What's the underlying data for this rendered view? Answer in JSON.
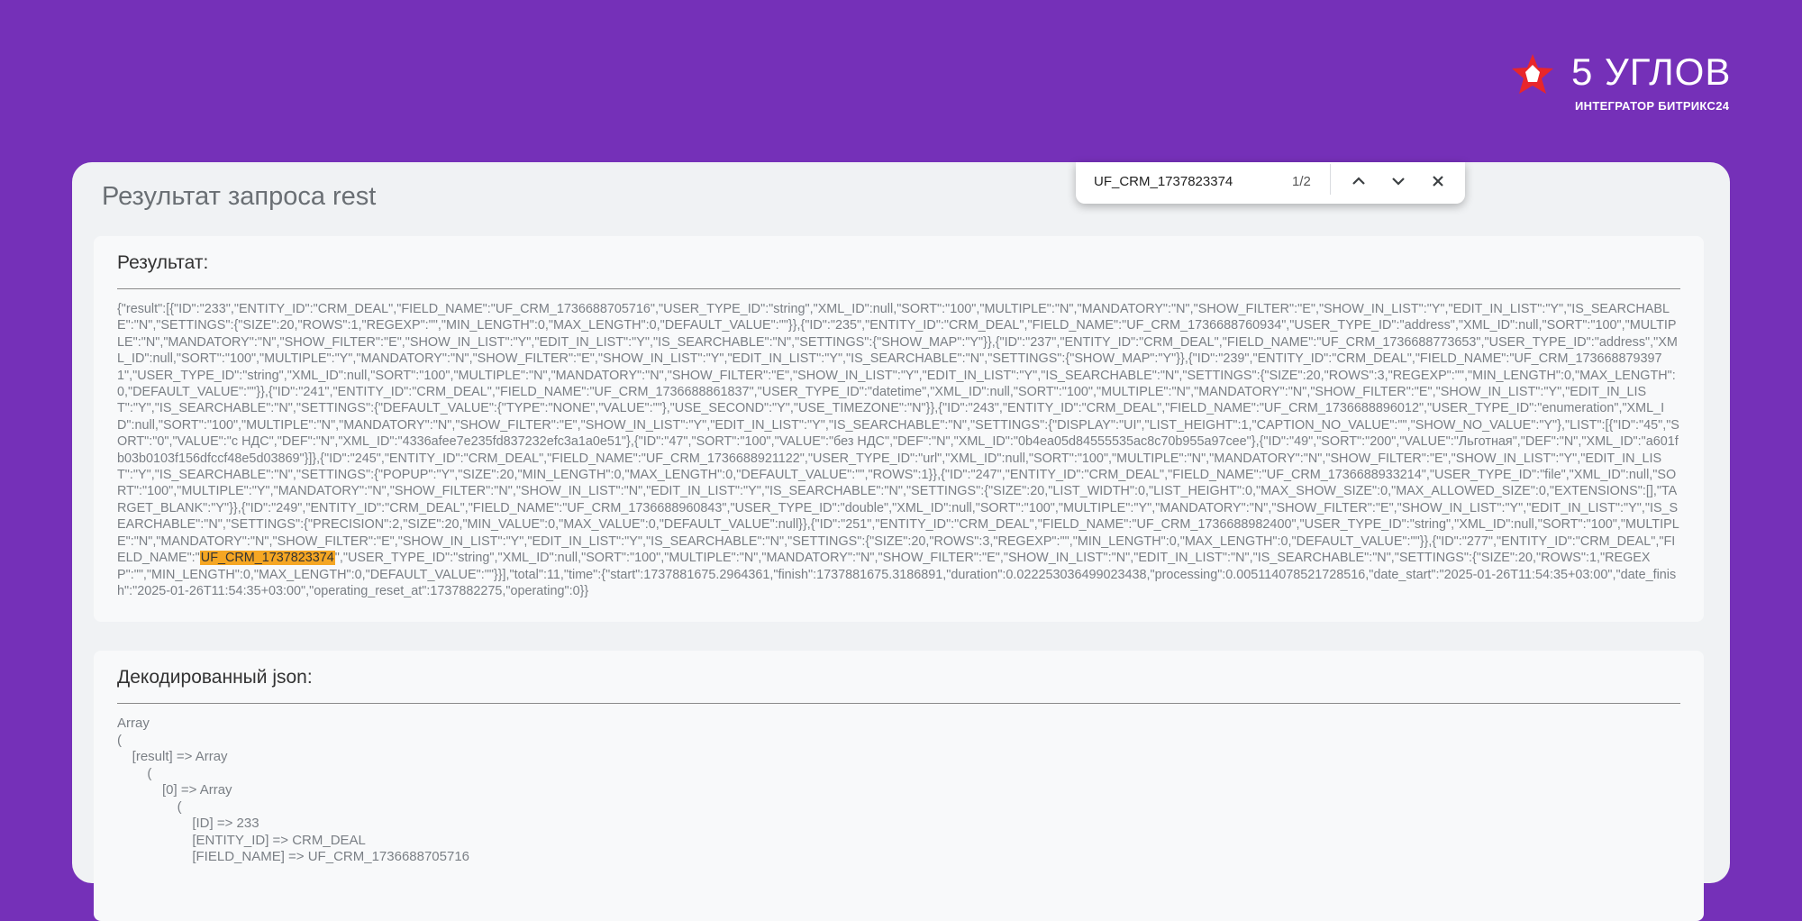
{
  "brand": {
    "name": "5 УГЛОВ",
    "tagline": "ИНТЕГРАТОР БИТРИКС24",
    "logo_icon": "red-star-icon",
    "colors": {
      "background": "#7530b8",
      "logo_accent": "#e8262b"
    }
  },
  "page": {
    "title": "Результат запроса rest"
  },
  "find_bar": {
    "query": "UF_CRM_1737823374",
    "count": "1/2",
    "icons": {
      "prev": "chevron-up-icon",
      "next": "chevron-down-icon",
      "close": "close-icon"
    },
    "highlight_color": "#f5a623"
  },
  "result": {
    "heading": "Результат:",
    "raw_before": "{\"result\":[{\"ID\":\"233\",\"ENTITY_ID\":\"CRM_DEAL\",\"FIELD_NAME\":\"UF_CRM_1736688705716\",\"USER_TYPE_ID\":\"string\",\"XML_ID\":null,\"SORT\":\"100\",\"MULTIPLE\":\"N\",\"MANDATORY\":\"N\",\"SHOW_FILTER\":\"E\",\"SHOW_IN_LIST\":\"Y\",\"EDIT_IN_LIST\":\"Y\",\"IS_SEARCHABLE\":\"N\",\"SETTINGS\":{\"SIZE\":20,\"ROWS\":1,\"REGEXP\":\"\",\"MIN_LENGTH\":0,\"MAX_LENGTH\":0,\"DEFAULT_VALUE\":\"\"}},{\"ID\":\"235\",\"ENTITY_ID\":\"CRM_DEAL\",\"FIELD_NAME\":\"UF_CRM_1736688760934\",\"USER_TYPE_ID\":\"address\",\"XML_ID\":null,\"SORT\":\"100\",\"MULTIPLE\":\"N\",\"MANDATORY\":\"N\",\"SHOW_FILTER\":\"E\",\"SHOW_IN_LIST\":\"Y\",\"EDIT_IN_LIST\":\"Y\",\"IS_SEARCHABLE\":\"N\",\"SETTINGS\":{\"SHOW_MAP\":\"Y\"}},{\"ID\":\"237\",\"ENTITY_ID\":\"CRM_DEAL\",\"FIELD_NAME\":\"UF_CRM_1736688773653\",\"USER_TYPE_ID\":\"address\",\"XML_ID\":null,\"SORT\":\"100\",\"MULTIPLE\":\"Y\",\"MANDATORY\":\"N\",\"SHOW_FILTER\":\"E\",\"SHOW_IN_LIST\":\"Y\",\"EDIT_IN_LIST\":\"Y\",\"IS_SEARCHABLE\":\"N\",\"SETTINGS\":{\"SHOW_MAP\":\"Y\"}},{\"ID\":\"239\",\"ENTITY_ID\":\"CRM_DEAL\",\"FIELD_NAME\":\"UF_CRM_1736688793971\",\"USER_TYPE_ID\":\"string\",\"XML_ID\":null,\"SORT\":\"100\",\"MULTIPLE\":\"N\",\"MANDATORY\":\"N\",\"SHOW_FILTER\":\"E\",\"SHOW_IN_LIST\":\"Y\",\"EDIT_IN_LIST\":\"Y\",\"IS_SEARCHABLE\":\"N\",\"SETTINGS\":{\"SIZE\":20,\"ROWS\":3,\"REGEXP\":\"\",\"MIN_LENGTH\":0,\"MAX_LENGTH\":0,\"DEFAULT_VALUE\":\"\"}},{\"ID\":\"241\",\"ENTITY_ID\":\"CRM_DEAL\",\"FIELD_NAME\":\"UF_CRM_1736688861837\",\"USER_TYPE_ID\":\"datetime\",\"XML_ID\":null,\"SORT\":\"100\",\"MULTIPLE\":\"N\",\"MANDATORY\":\"N\",\"SHOW_FILTER\":\"E\",\"SHOW_IN_LIST\":\"Y\",\"EDIT_IN_LIST\":\"Y\",\"IS_SEARCHABLE\":\"N\",\"SETTINGS\":{\"DEFAULT_VALUE\":{\"TYPE\":\"NONE\",\"VALUE\":\"\"},\"USE_SECOND\":\"Y\",\"USE_TIMEZONE\":\"N\"}},{\"ID\":\"243\",\"ENTITY_ID\":\"CRM_DEAL\",\"FIELD_NAME\":\"UF_CRM_1736688896012\",\"USER_TYPE_ID\":\"enumeration\",\"XML_ID\":null,\"SORT\":\"100\",\"MULTIPLE\":\"N\",\"MANDATORY\":\"N\",\"SHOW_FILTER\":\"E\",\"SHOW_IN_LIST\":\"Y\",\"EDIT_IN_LIST\":\"Y\",\"IS_SEARCHABLE\":\"N\",\"SETTINGS\":{\"DISPLAY\":\"UI\",\"LIST_HEIGHT\":1,\"CAPTION_NO_VALUE\":\"\",\"SHOW_NO_VALUE\":\"Y\"},\"LIST\":[{\"ID\":\"45\",\"SORT\":\"0\",\"VALUE\":\"с НДС\",\"DEF\":\"N\",\"XML_ID\":\"4336afee7e235fd837232efc3a1a0e51\"},{\"ID\":\"47\",\"SORT\":\"100\",\"VALUE\":\"без НДС\",\"DEF\":\"N\",\"XML_ID\":\"0b4ea05d84555535ac8c70b955a97cee\"},{\"ID\":\"49\",\"SORT\":\"200\",\"VALUE\":\"Льготная\",\"DEF\":\"N\",\"XML_ID\":\"a601fb03b0103f156dfccf48e5d03869\"}]},{\"ID\":\"245\",\"ENTITY_ID\":\"CRM_DEAL\",\"FIELD_NAME\":\"UF_CRM_1736688921122\",\"USER_TYPE_ID\":\"url\",\"XML_ID\":null,\"SORT\":\"100\",\"MULTIPLE\":\"N\",\"MANDATORY\":\"N\",\"SHOW_FILTER\":\"E\",\"SHOW_IN_LIST\":\"Y\",\"EDIT_IN_LIST\":\"Y\",\"IS_SEARCHABLE\":\"N\",\"SETTINGS\":{\"POPUP\":\"Y\",\"SIZE\":20,\"MIN_LENGTH\":0,\"MAX_LENGTH\":0,\"DEFAULT_VALUE\":\"\",\"ROWS\":1}},{\"ID\":\"247\",\"ENTITY_ID\":\"CRM_DEAL\",\"FIELD_NAME\":\"UF_CRM_1736688933214\",\"USER_TYPE_ID\":\"file\",\"XML_ID\":null,\"SORT\":\"100\",\"MULTIPLE\":\"Y\",\"MANDATORY\":\"N\",\"SHOW_FILTER\":\"N\",\"SHOW_IN_LIST\":\"N\",\"EDIT_IN_LIST\":\"Y\",\"IS_SEARCHABLE\":\"N\",\"SETTINGS\":{\"SIZE\":20,\"LIST_WIDTH\":0,\"LIST_HEIGHT\":0,\"MAX_SHOW_SIZE\":0,\"MAX_ALLOWED_SIZE\":0,\"EXTENSIONS\":[],\"TARGET_BLANK\":\"Y\"}},{\"ID\":\"249\",\"ENTITY_ID\":\"CRM_DEAL\",\"FIELD_NAME\":\"UF_CRM_1736688960843\",\"USER_TYPE_ID\":\"double\",\"XML_ID\":null,\"SORT\":\"100\",\"MULTIPLE\":\"Y\",\"MANDATORY\":\"N\",\"SHOW_FILTER\":\"E\",\"SHOW_IN_LIST\":\"Y\",\"EDIT_IN_LIST\":\"Y\",\"IS_SEARCHABLE\":\"N\",\"SETTINGS\":{\"PRECISION\":2,\"SIZE\":20,\"MIN_VALUE\":0,\"MAX_VALUE\":0,\"DEFAULT_VALUE\":null}},{\"ID\":\"251\",\"ENTITY_ID\":\"CRM_DEAL\",\"FIELD_NAME\":\"UF_CRM_1736688982400\",\"USER_TYPE_ID\":\"string\",\"XML_ID\":null,\"SORT\":\"100\",\"MULTIPLE\":\"N\",\"MANDATORY\":\"N\",\"SHOW_FILTER\":\"E\",\"SHOW_IN_LIST\":\"Y\",\"EDIT_IN_LIST\":\"Y\",\"IS_SEARCHABLE\":\"N\",\"SETTINGS\":{\"SIZE\":20,\"ROWS\":3,\"REGEXP\":\"\",\"MIN_LENGTH\":0,\"MAX_LENGTH\":0,\"DEFAULT_VALUE\":\"\"}},{\"ID\":\"277\",\"ENTITY_ID\":\"CRM_DEAL\",\"FIELD_NAME\":\"",
    "raw_match": "UF_CRM_1737823374",
    "raw_after": "\",\"USER_TYPE_ID\":\"string\",\"XML_ID\":null,\"SORT\":\"100\",\"MULTIPLE\":\"N\",\"MANDATORY\":\"N\",\"SHOW_FILTER\":\"E\",\"SHOW_IN_LIST\":\"N\",\"EDIT_IN_LIST\":\"N\",\"IS_SEARCHABLE\":\"N\",\"SETTINGS\":{\"SIZE\":20,\"ROWS\":1,\"REGEXP\":\"\",\"MIN_LENGTH\":0,\"MAX_LENGTH\":0,\"DEFAULT_VALUE\":\"\"}}],\"total\":11,\"time\":{\"start\":1737881675.2964361,\"finish\":1737881675.3186891,\"duration\":0.022253036499023438,\"processing\":0.005114078521728516,\"date_start\":\"2025-01-26T11:54:35+03:00\",\"date_finish\":\"2025-01-26T11:54:35+03:00\",\"operating_reset_at\":1737882275,\"operating\":0}}"
  },
  "decoded": {
    "heading": "Декодированный json:",
    "lines": [
      "Array",
      "(",
      "    [result] => Array",
      "        (",
      "            [0] => Array",
      "                (",
      "                    [ID] => 233",
      "                    [ENTITY_ID] => CRM_DEAL",
      "                    [FIELD_NAME] => UF_CRM_1736688705716"
    ]
  }
}
